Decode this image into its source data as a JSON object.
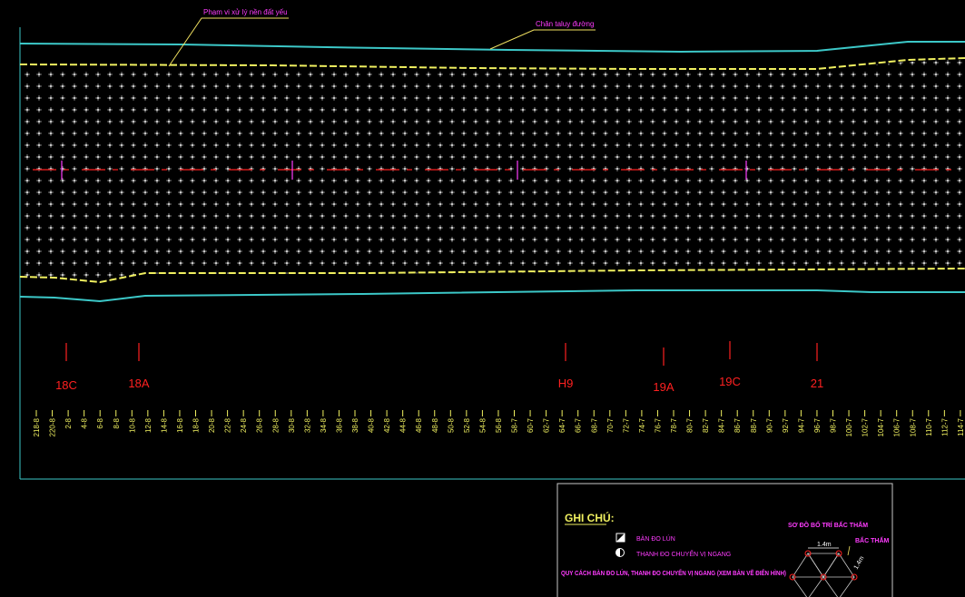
{
  "callouts": {
    "treatment_zone": "Phạm vi xử lý nền đất yếu",
    "road_toe": "Chân taluy đường"
  },
  "markers": [
    {
      "label": "18C"
    },
    {
      "label": "18A"
    },
    {
      "label": "H9"
    },
    {
      "label": "19A"
    },
    {
      "label": "19C"
    },
    {
      "label": "21"
    }
  ],
  "stations": [
    "218-8",
    "220-8",
    "2-8",
    "4-8",
    "6-8",
    "8-8",
    "10-8",
    "12-8",
    "14-8",
    "16-8",
    "18-8",
    "20-8",
    "22-8",
    "24-8",
    "26-8",
    "28-8",
    "30-8",
    "32-8",
    "34-8",
    "36-8",
    "38-8",
    "40-8",
    "42-8",
    "44-8",
    "46-8",
    "48-8",
    "50-8",
    "52-8",
    "54-8",
    "56-8",
    "58-7",
    "60-7",
    "62-7",
    "64-7",
    "66-7",
    "68-7",
    "70-7",
    "72-7",
    "74-7",
    "76-7",
    "78-7",
    "80-7",
    "82-7",
    "84-7",
    "86-7",
    "88-7",
    "90-7",
    "92-7",
    "94-7",
    "96-7",
    "98-7",
    "100-7",
    "102-7",
    "104-7",
    "106-7",
    "108-7",
    "110-7",
    "112-7",
    "114-7",
    "116-7"
  ],
  "legend": {
    "title": "GHI CHÚ:",
    "items": [
      {
        "symbol": "settlement-plate",
        "label": "BÀN ĐO LÚN"
      },
      {
        "symbol": "displacement-bar",
        "label": "THANH ĐO CHUYỂN VỊ NGANG"
      }
    ],
    "spec_note": "QUY CÁCH BÀN ĐO LÚN, THANH ĐO CHUYỂN VỊ NGANG (XEM BẢN VẼ ĐIỂN HÌNH)",
    "layout_title": "SƠ ĐỒ BỐ TRÍ BẤC THẤM",
    "spacing_label": "1.4m",
    "wick_label": "BẤC THẤM",
    "diag_label": "1.4m"
  },
  "colors": {
    "background": "#000000",
    "road_edge": "#3cc8c8",
    "boundary": "#f0f060",
    "leader": "#f0e060",
    "callout_text": "#ff3cff",
    "grid_dots": "#c8c8c8",
    "marker": "#ff2020",
    "station_text": "#f0f060",
    "station_tick": "#f0f060",
    "legend_title": "#f0f060",
    "legend_text": "#ff3cff"
  }
}
